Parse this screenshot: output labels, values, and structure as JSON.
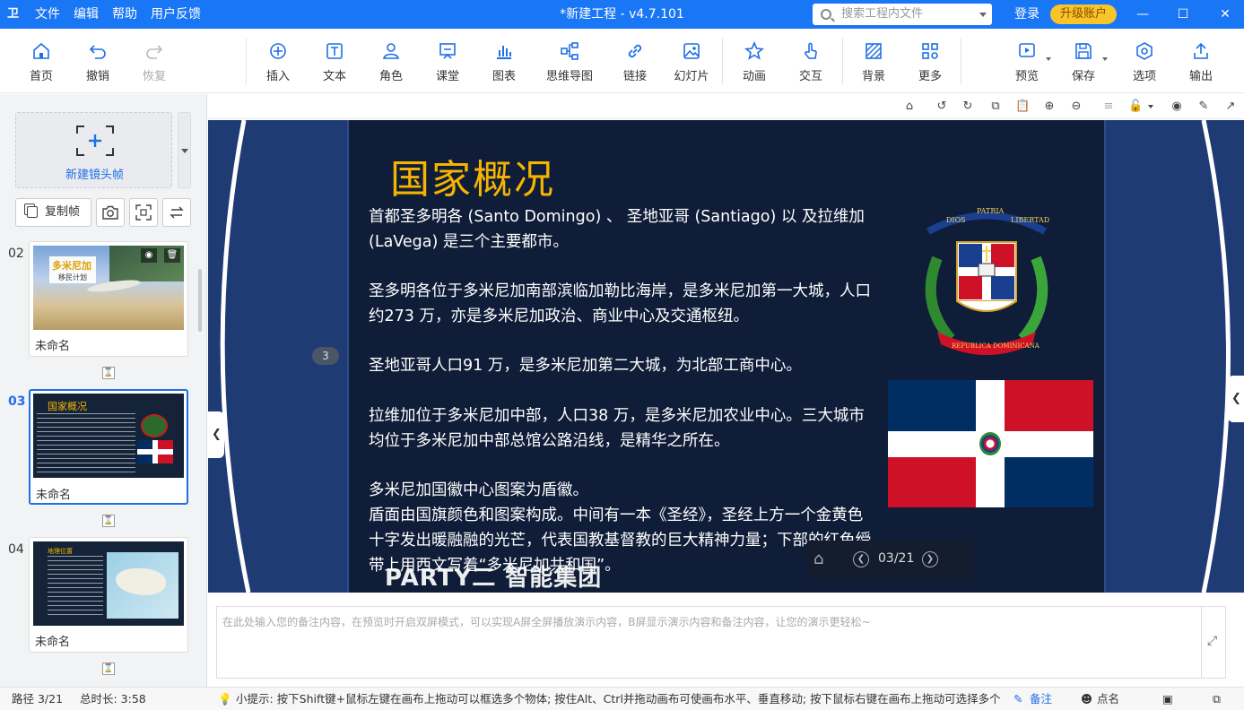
{
  "app": {
    "title": "*新建工程 - v4.7.101",
    "menu": [
      "文件",
      "编辑",
      "帮助",
      "用户反馈"
    ],
    "search_placeholder": "搜索工程内文件",
    "login": "登录",
    "upgrade": "升级账户"
  },
  "toolbar": [
    {
      "label": "首页",
      "icon": "home-icon"
    },
    {
      "label": "撤销",
      "icon": "undo-icon"
    },
    {
      "label": "恢复",
      "icon": "redo-icon",
      "disabled": true
    },
    {
      "label": "插入",
      "icon": "plus-circle-icon"
    },
    {
      "label": "文本",
      "icon": "text-icon"
    },
    {
      "label": "角色",
      "icon": "character-icon"
    },
    {
      "label": "课堂",
      "icon": "classroom-icon"
    },
    {
      "label": "图表",
      "icon": "bar-chart-icon"
    },
    {
      "label": "思维导图",
      "icon": "mindmap-icon"
    },
    {
      "label": "链接",
      "icon": "link-icon"
    },
    {
      "label": "幻灯片",
      "icon": "image-icon"
    },
    {
      "label": "动画",
      "icon": "star-icon"
    },
    {
      "label": "交互",
      "icon": "hand-icon"
    },
    {
      "label": "背景",
      "icon": "background-icon"
    },
    {
      "label": "更多",
      "icon": "grid-icon"
    },
    {
      "label": "预览",
      "icon": "play-icon"
    },
    {
      "label": "保存",
      "icon": "save-icon"
    },
    {
      "label": "选项",
      "icon": "settings-icon"
    },
    {
      "label": "输出",
      "icon": "export-icon"
    }
  ],
  "left_panel": {
    "new_frame": "新建镜头帧",
    "copy_frame": "复制帧",
    "slides": [
      {
        "number": "02",
        "name": "未命名",
        "thumb_title": "多米尼加",
        "thumb_subtitle": "移民计划"
      },
      {
        "number": "03",
        "name": "未命名",
        "thumb_title": "国家概况",
        "active": true
      },
      {
        "number": "04",
        "name": "未命名",
        "thumb_title": "地理位置"
      }
    ]
  },
  "slide": {
    "title": "国家概况",
    "paragraphs": [
      "首都圣多明各 (Santo Domingo) 、 圣地亚哥 (Santiago) 以 及拉维加 (LaVega) 是三个主要都市。",
      "圣多明各位于多米尼加南部滨临加勒比海岸，是多米尼加第一大城，人口约273 万，亦是多米尼加政治、商业中心及交通枢纽。",
      "圣地亚哥人口91 万，是多米尼加第二大城，为北部工商中心。",
      "拉维加位于多米尼加中部，人口38 万，是多米尼加农业中心。三大城市均位于多米尼加中部总馆公路沿线，是精华之所在。",
      "多米尼加国徽中心图案为盾徽。",
      "盾面由国旗颜色和图案构成。中间有一本《圣经》，圣经上方一个金黄色十字发出暖融融的光芒，代表国教基督教的巨大精神力量；下部的红色绶带上用西文写着“多米尼加共和国”。"
    ],
    "overlay_text": "PARTY二 智能集团",
    "emblem_text": [
      "DIOS",
      "PATRIA",
      "LIBERTAD",
      "REPUBLICA DOMINICANA"
    ],
    "badge": "3",
    "page_indicator": "03/21"
  },
  "notes_placeholder": "在此处输入您的备注内容，在预览时开启双屏模式，可以实现A屏全屏播放演示内容，B屏显示演示内容和备注内容，让您的演示更轻松~",
  "status": {
    "path": "路径 3/21",
    "duration": "总时长: 3:58",
    "tip": "小提示: 按下Shift键+鼠标左键在画布上拖动可以框选多个物体; 按住Alt、Ctrl并拖动画布可使画布水平、垂直移动; 按下鼠标右键在画布上拖动可选择多个对象;",
    "notes_btn": "备注",
    "rollcall_btn": "点名"
  },
  "colors": {
    "brand": "#1976f5",
    "accent": "#1f6fe6",
    "slide_bg": "#0f1d38",
    "title_gold": "#f5b400",
    "flag_blue": "#002d62",
    "flag_red": "#ce1126"
  }
}
